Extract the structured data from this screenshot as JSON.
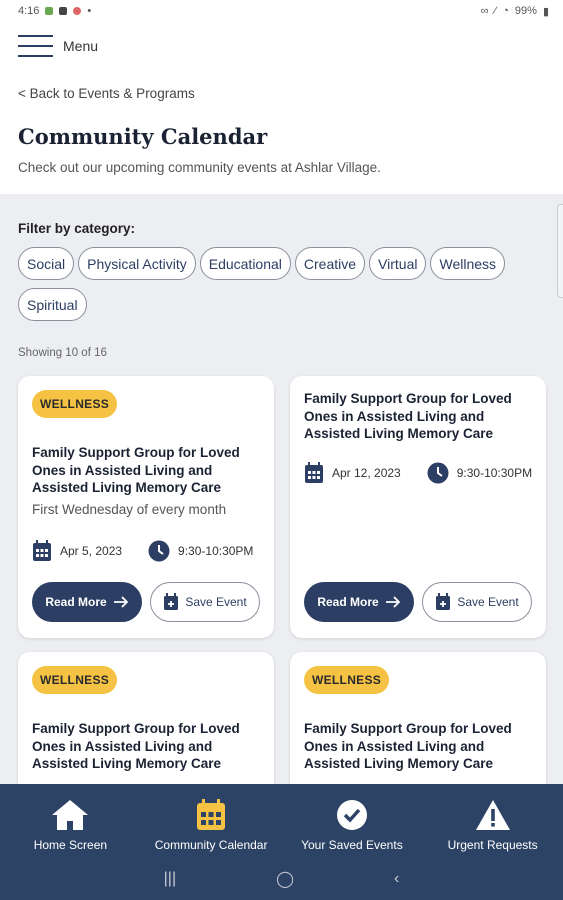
{
  "status_bar": {
    "time": "4:16",
    "battery": "99%"
  },
  "header": {
    "menu_label": "Menu",
    "back_link": "< Back to Events & Programs",
    "title": "Community Calendar",
    "subtitle": "Check out our upcoming community events at Ashlar Village."
  },
  "filter": {
    "label": "Filter by category:",
    "chips": [
      "Social",
      "Physical Activity",
      "Educational",
      "Creative",
      "Virtual",
      "Wellness",
      "Spiritual"
    ]
  },
  "showing": "Showing 10 of 16",
  "cards": [
    {
      "badge": "WELLNESS",
      "title": "Family Support Group for Loved Ones in Assisted Living and Assisted Living Memory Care",
      "frequency": "First Wednesday of every month",
      "date": "Apr 5, 2023",
      "time": "9:30-10:30PM",
      "read_more": "Read More",
      "save_event": "Save Event"
    },
    {
      "badge": "",
      "title": "Family Support Group for Loved Ones in Assisted Living and Assisted Living Memory Care",
      "frequency": "",
      "date": "Apr 12, 2023",
      "time": "9:30-10:30PM",
      "read_more": "Read More",
      "save_event": "Save Event"
    },
    {
      "badge": "WELLNESS",
      "title": "Family Support Group for Loved Ones in Assisted Living and Assisted Living Memory Care"
    },
    {
      "badge": "WELLNESS",
      "title": "Family Support Group for Loved Ones in Assisted Living and Assisted Living Memory Care"
    }
  ],
  "bottom_nav": [
    {
      "label": "Home Screen",
      "icon": "home-icon"
    },
    {
      "label": "Community Calendar",
      "icon": "calendar-icon"
    },
    {
      "label": "Your Saved Events",
      "icon": "check-circle-icon"
    },
    {
      "label": "Urgent Requests",
      "icon": "warning-icon"
    }
  ],
  "colors": {
    "primary": "#2c3e63",
    "badge": "#f5c244",
    "nav_bg": "#2c4366",
    "calendar_accent": "#f5c244"
  }
}
